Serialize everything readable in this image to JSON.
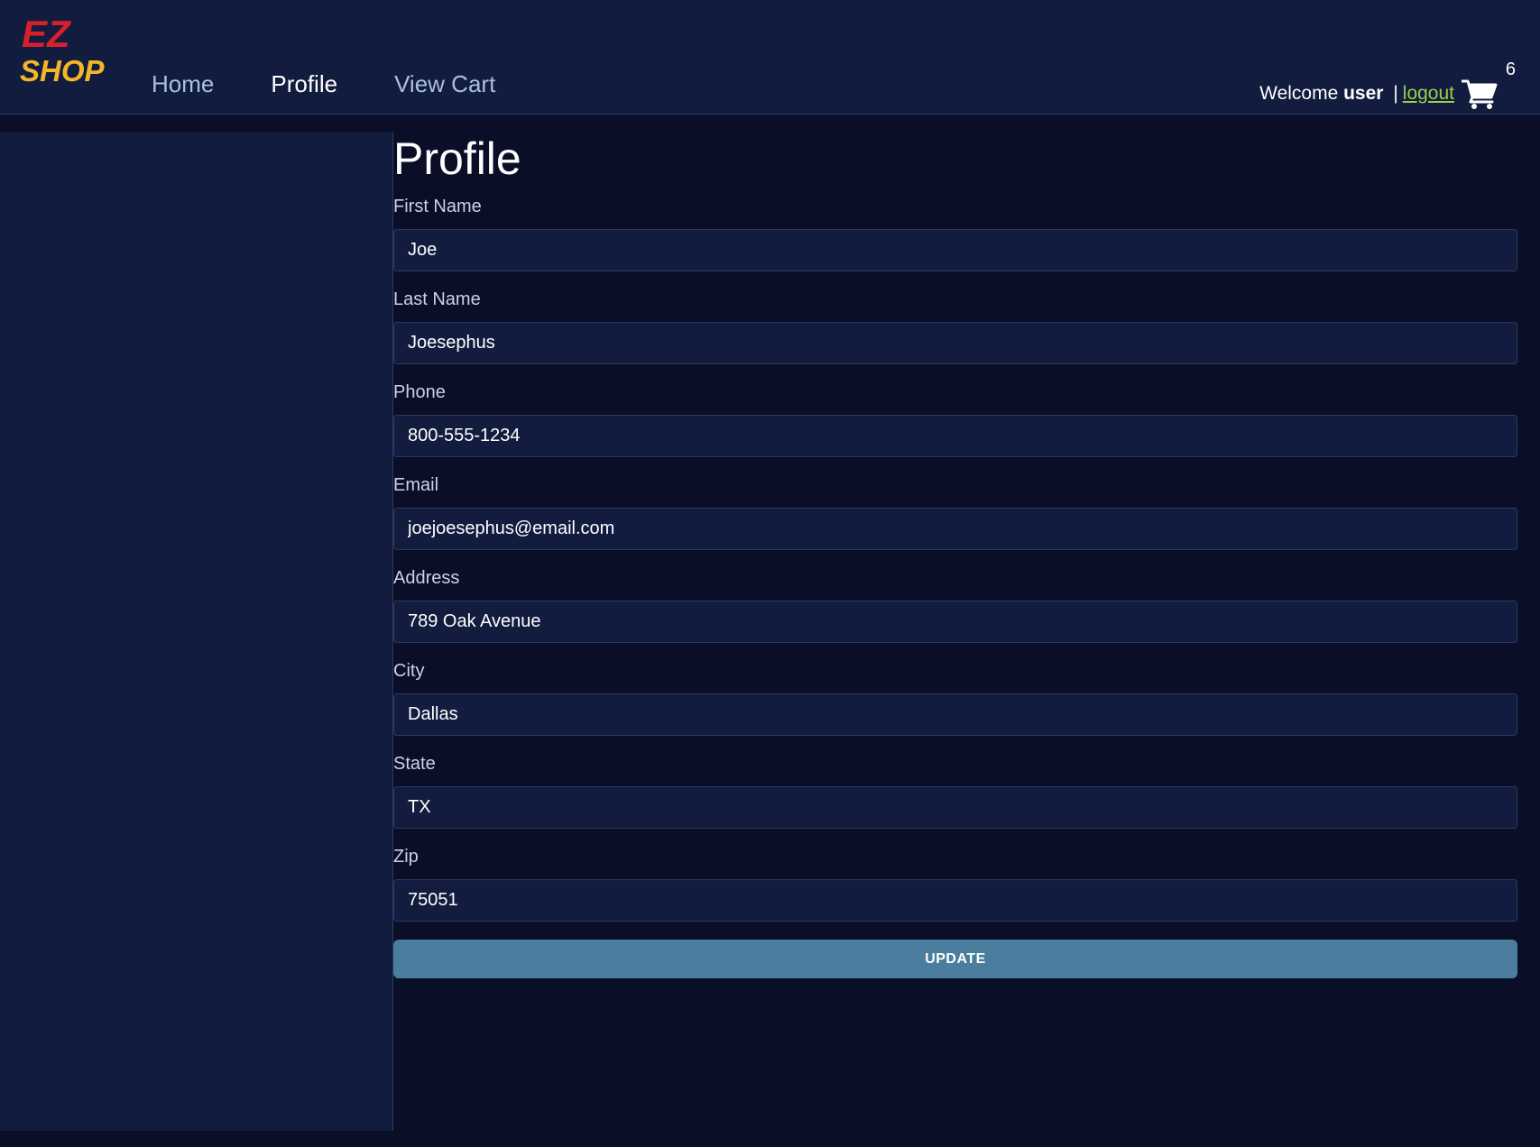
{
  "brand": {
    "logo_line1": "EZ",
    "logo_line2": "SHOP"
  },
  "nav": [
    {
      "label": "Home"
    },
    {
      "label": "Profile",
      "active": true
    },
    {
      "label": "View Cart"
    }
  ],
  "user": {
    "welcome": "Welcome",
    "username": "user",
    "separator": "|",
    "logout": "logout"
  },
  "cart": {
    "icon": "cart-icon",
    "count": "6"
  },
  "page": {
    "title": "Profile"
  },
  "form": {
    "fields": [
      {
        "label": "First Name",
        "value": "Joe"
      },
      {
        "label": "Last Name",
        "value": "Joesephus"
      },
      {
        "label": "Phone",
        "value": "800-555-1234"
      },
      {
        "label": "Email",
        "value": "joejoesephus@email.com"
      },
      {
        "label": "Address",
        "value": "789 Oak Avenue"
      },
      {
        "label": "City",
        "value": "Dallas"
      },
      {
        "label": "State",
        "value": "TX"
      },
      {
        "label": "Zip",
        "value": "75051"
      }
    ],
    "submit_label": "UPDATE"
  },
  "colors": {
    "background": "#0a0e26",
    "panel": "#111c3e",
    "logo_red": "#d8202c",
    "logo_yellow": "#f4b52a",
    "link_green": "#9bd04a",
    "button": "#4a7d9e"
  }
}
